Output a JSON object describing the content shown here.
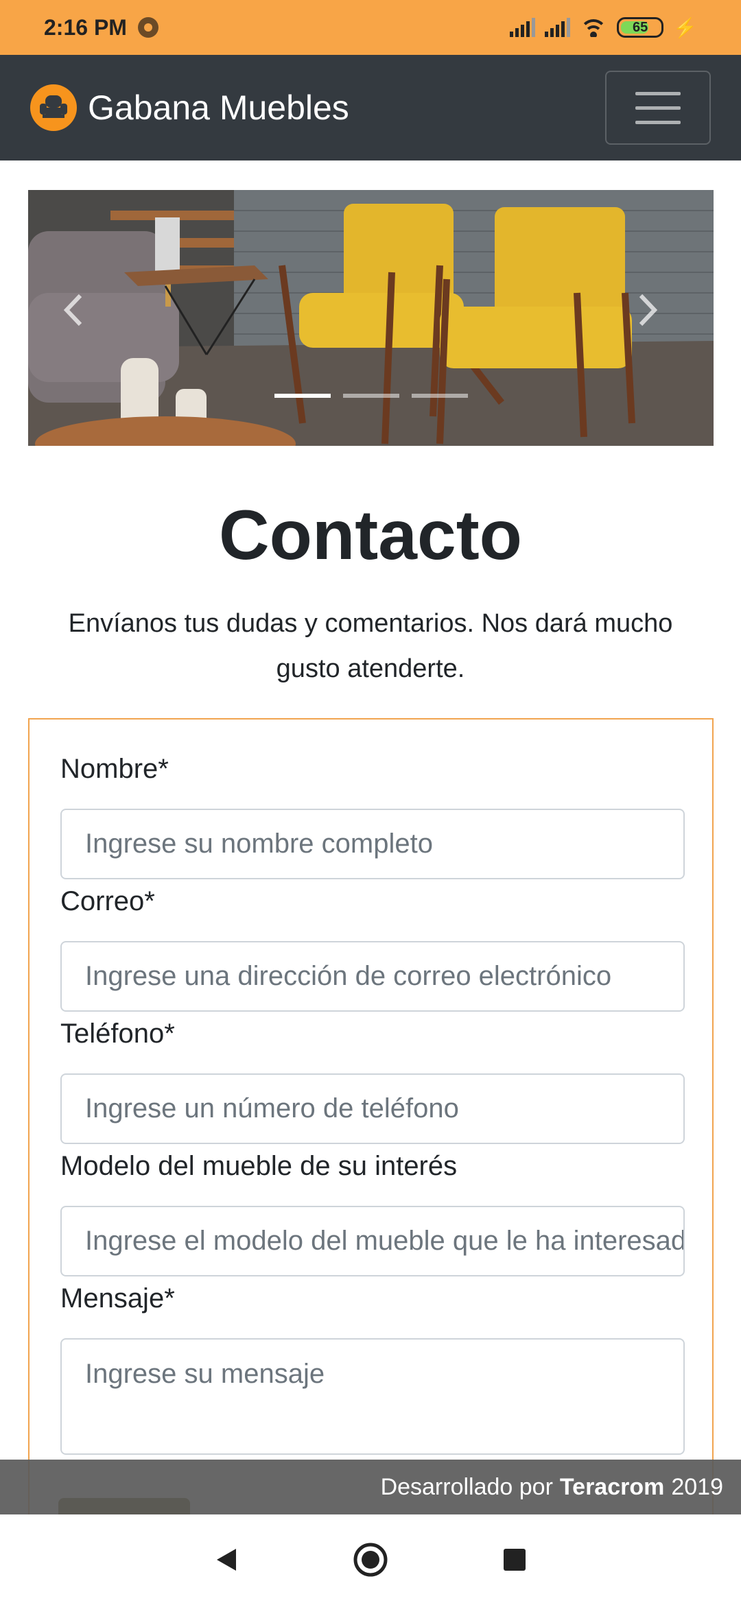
{
  "status_bar": {
    "time": "2:16 PM",
    "battery": "65"
  },
  "navbar": {
    "brand": "Gabana Muebles",
    "logo_icon": "armchair-icon",
    "toggler_icon": "hamburger-icon"
  },
  "carousel": {
    "slide_count": 3,
    "active_index": 0
  },
  "page": {
    "title": "Contacto",
    "subtitle": "Envíanos tus dudas y comentarios. Nos dará mucho gusto atenderte."
  },
  "form": {
    "nombre_label": "Nombre*",
    "nombre_placeholder": "Ingrese su nombre completo",
    "correo_label": "Correo*",
    "correo_placeholder": "Ingrese una dirección de correo electrónico",
    "telefono_label": "Teléfono*",
    "telefono_placeholder": "Ingrese un número de teléfono",
    "modelo_label": "Modelo del mueble de su interés",
    "modelo_placeholder": "Ingrese el modelo del mueble que le ha interesado",
    "mensaje_label": "Mensaje*",
    "mensaje_placeholder": "Ingrese su mensaje"
  },
  "footer": {
    "prefix": "Desarrollado por",
    "company": "Teracrom",
    "year": "2019"
  },
  "colors": {
    "status_bar": "#f8a547",
    "navbar": "#343a40",
    "accent_orange": "#f7941d",
    "form_border": "#f1a44f"
  }
}
